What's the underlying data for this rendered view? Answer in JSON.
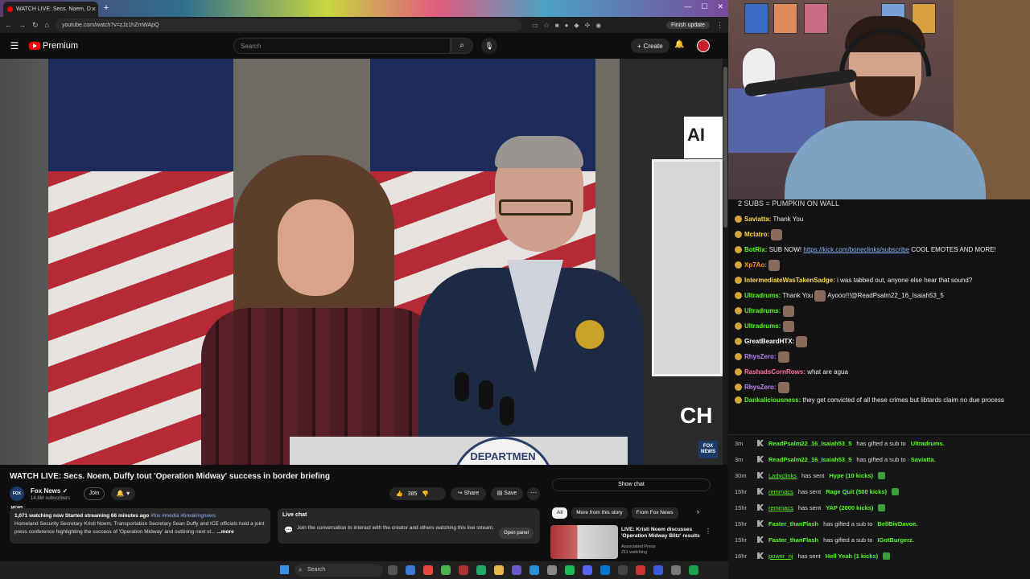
{
  "browser": {
    "tab_title": "WATCH LIVE: Secs. Noem, D",
    "url": "youtube.com/watch?v=zJz1hZmWApQ",
    "finish_update": "Finish update"
  },
  "youtube": {
    "logo_text": "Premium",
    "search_placeholder": "Search",
    "create_label": "Create"
  },
  "video": {
    "title": "WATCH LIVE: Secs. Noem, Duffy tout 'Operation Midway' success in border briefing",
    "sign_text": "AI",
    "ch_text": "CH",
    "seal_text": "DEPARTMEN",
    "bug_text": "FOX NEWS"
  },
  "channel": {
    "avatar_text": "FOX NEWS",
    "name": "Fox News",
    "subscribers": "14.6M subscribers",
    "join_label": "Join",
    "likes": "385",
    "share_label": "Share",
    "save_label": "Save"
  },
  "description": {
    "stats": "1,071 watching now  Started streaming 66 minutes ago",
    "tags": "#fox #media #breakingnews",
    "body": "Homeland Security Secretary Kristi Noem, Transportation Secretary Sean Duffy and ICE officials hold a joint press conference highlighting the success of 'Operation Midway' and outlining next st...",
    "more": "...more"
  },
  "live_chat_box": {
    "title": "Live chat",
    "text": "Join the conversation to interact with the creator and others watching this live stream.",
    "open_panel": "Open panel"
  },
  "sidebar": {
    "show_chat": "Show chat",
    "chips": [
      "All",
      "More from this story",
      "From Fox News"
    ],
    "rec": {
      "title": "LIVE: Kristi Noem discusses 'Operation Midway Blitz' results",
      "channel": "Associated Press",
      "watching": "211 watching"
    }
  },
  "taskbar": {
    "search_label": "Search"
  },
  "chat": {
    "goal": "2 SUBS = PUMPKIN ON WALL",
    "messages": [
      {
        "user": "Saviatta:",
        "color": "#ffd84a",
        "text": "Thank You"
      },
      {
        "user": "Mclatro:",
        "color": "#ffd84a",
        "text": ""
      },
      {
        "user": "BotRix:",
        "color": "#53fc18",
        "text": "SUB NOW!",
        "link": "https://kick.com/boneclinks/subscribe",
        "text2": "COOL EMOTES AND MORE!"
      },
      {
        "user": "Xp7Ao:",
        "color": "#ff9900",
        "text": ""
      },
      {
        "user": "IntermediateWasTakenSadge:",
        "color": "#ffd84a",
        "text": "i was tabbed out, anyone else hear that sound?"
      },
      {
        "user": "Ultradrums:",
        "color": "#53fc18",
        "text": "Thank You",
        "text2": "Ayooo!!!@ReadPsalm22_16_Isaiah53_5"
      },
      {
        "user": "Ultradrums:",
        "color": "#53fc18",
        "text": ""
      },
      {
        "user": "Ultradrums:",
        "color": "#53fc18",
        "text": ""
      },
      {
        "user": "GreatBeardHTX:",
        "color": "#ffffff",
        "text": ""
      },
      {
        "user": "RhysZero:",
        "color": "#c084fc",
        "text": ""
      },
      {
        "user": "RashadsCornRows:",
        "color": "#ff6fa8",
        "text": "what are agua"
      },
      {
        "user": "RhysZero:",
        "color": "#c084fc",
        "text": ""
      },
      {
        "user": "Dankaliciousness:",
        "color": "#53fc18",
        "text": "they get convicted of all these crimes but libtards claim no due process"
      }
    ]
  },
  "events": [
    {
      "time": "3m",
      "user": "ReadPsalm22_16_Isaiah53_5",
      "action": "has gifted a sub to",
      "target": "Ultradrums."
    },
    {
      "time": "3m",
      "user": "ReadPsalm22_16_Isaiah53_5",
      "action": "has gifted a sub to",
      "target": "Saviatta."
    },
    {
      "time": "30m",
      "user": "Ladyclinks",
      "action": "has sent",
      "target": "Hype (10 kicks)"
    },
    {
      "time": "15hr",
      "user": "remmacs",
      "action": "has sent",
      "target": "Rage Quit (500 kicks)"
    },
    {
      "time": "15hr",
      "user": "remmacs",
      "action": "has sent",
      "target": "YAP (2000 kicks)"
    },
    {
      "time": "15hr",
      "user": "Faster_thanFlash",
      "action": "has gifted a sub to",
      "target": "BellBivDavoe."
    },
    {
      "time": "15hr",
      "user": "Faster_thanFlash",
      "action": "has gifted a sub to",
      "target": "IGotBurgerz."
    },
    {
      "time": "16hr",
      "user": "power_nj",
      "action": "has sent",
      "target": "Hell Yeah (1 kicks)"
    }
  ]
}
